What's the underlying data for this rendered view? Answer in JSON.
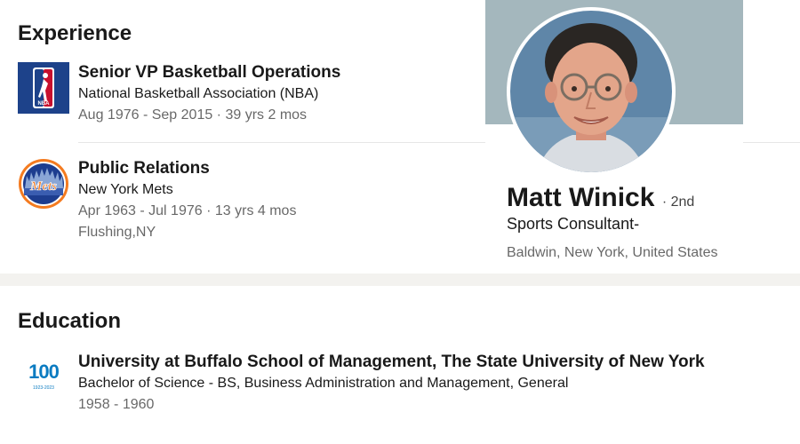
{
  "experience": {
    "section_title": "Experience",
    "entries": [
      {
        "logo": "nba-logo",
        "title": "Senior VP Basketball Operations",
        "company": "National Basketball Association (NBA)",
        "dates": "Aug 1976 - Sep 2015 · 39 yrs 2 mos",
        "location": "",
        "logo_text": "NBA"
      },
      {
        "logo": "mets-logo",
        "title": "Public Relations",
        "company": "New York Mets",
        "dates": "Apr 1963 - Jul 1976 · 13 yrs 4 mos",
        "location": "Flushing,NY",
        "logo_text": "Mets"
      }
    ]
  },
  "education": {
    "section_title": "Education",
    "entries": [
      {
        "logo": "ub-100-logo",
        "logo_text": "100",
        "logo_subtext": "1923-2023",
        "school": "University at Buffalo School of Management, The State University of New York",
        "degree": "Bachelor of Science - BS, Business Administration and Management, General",
        "dates": "1958 - 1960"
      }
    ]
  },
  "profile": {
    "name": "Matt Winick",
    "degree": "· 2nd",
    "headline": "Sports Consultant-",
    "location": "Baldwin, New York, United States"
  },
  "colors": {
    "banner": "#a4b7bd",
    "nba_blue": "#1d428a",
    "nba_red": "#c8102e",
    "mets_blue": "#1d3d8f",
    "mets_orange": "#f47b20",
    "ub_blue": "#0a7bc1"
  }
}
